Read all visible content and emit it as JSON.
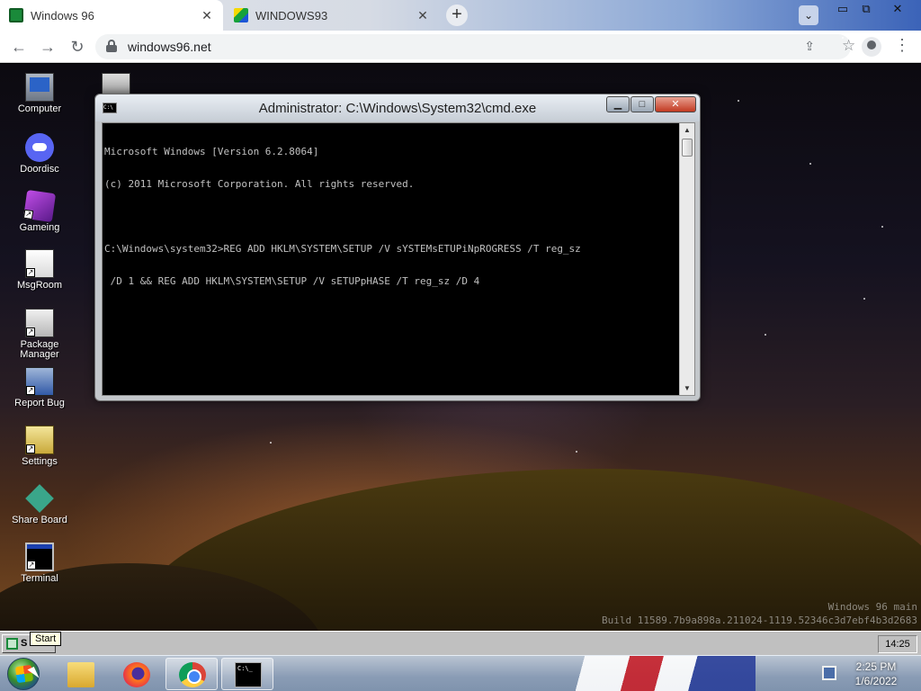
{
  "browser": {
    "tabs": [
      {
        "title": "Windows 96",
        "active": true
      },
      {
        "title": "WINDOWS93",
        "active": false
      }
    ],
    "new_tab_label": "+",
    "url": "windows96.net"
  },
  "desktop": {
    "icons": [
      {
        "label": "Computer",
        "icon": "computer-icon"
      },
      {
        "label": "Doordisc",
        "icon": "discord-icon"
      },
      {
        "label": "Gameing",
        "icon": "cube-icon"
      },
      {
        "label": "MsgRoom",
        "icon": "chat-icon"
      },
      {
        "label": "Package Manager",
        "icon": "package-icon"
      },
      {
        "label": "Report Bug",
        "icon": "bug-report-icon"
      },
      {
        "label": "Settings",
        "icon": "settings-icon"
      },
      {
        "label": "Share Board",
        "icon": "share-icon"
      },
      {
        "label": "Terminal",
        "icon": "terminal-icon"
      }
    ],
    "watermark_line1": "Windows 96 main",
    "watermark_line2": "Build 11589.7b9a898a.211024-1119.52346c3d7ebf4b3d2683"
  },
  "cmd_window": {
    "title": "Administrator: C:\\Windows\\System32\\cmd.exe",
    "console_lines": [
      "Microsoft Windows [Version 6.2.8064]",
      "(c) 2011 Microsoft Corporation. All rights reserved.",
      "",
      "C:\\Windows\\system32>REG ADD HKLM\\SYSTEM\\SETUP /V sYSTEMsETUPiNpROGRESS /T reg_sz",
      " /D 1 && REG ADD HKLM\\SYSTEM\\SETUP /V sETUPpHASE /T reg_sz /D 4"
    ]
  },
  "w96_taskbar": {
    "start_label": "S",
    "start_tooltip": "Start",
    "tray_time": "14:25"
  },
  "host_taskbar": {
    "apps": [
      "explorer-icon",
      "firefox-icon",
      "chrome-icon",
      "cmd-icon"
    ],
    "clock_time": "2:25 PM",
    "clock_date": "1/6/2022"
  }
}
